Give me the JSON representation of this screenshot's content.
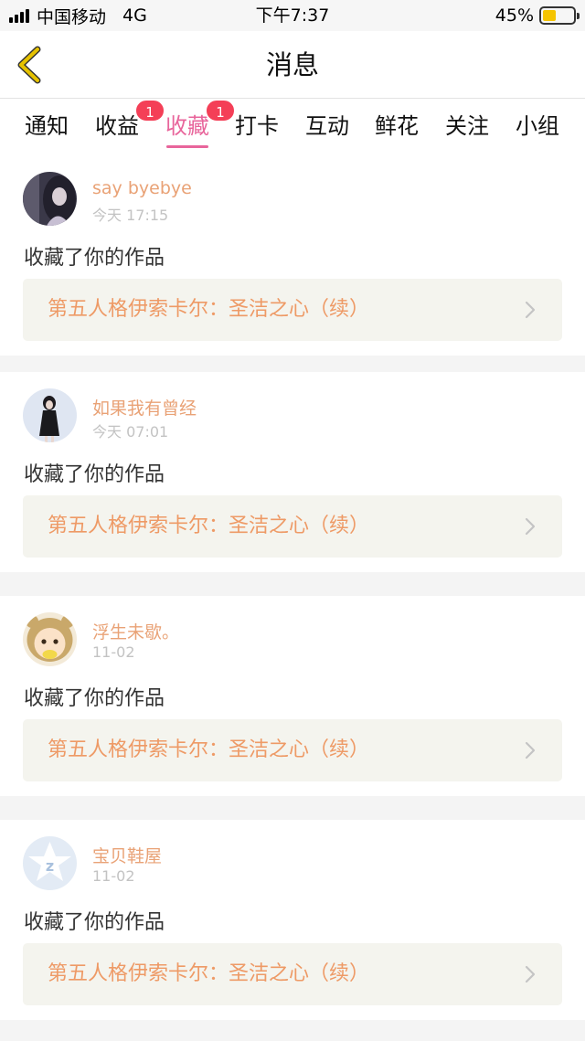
{
  "status_bar": {
    "carrier": "中国移动",
    "network": "4G",
    "time": "下午7:37",
    "battery": "45%",
    "battery_level": 0.45,
    "battery_color": "#f5c400"
  },
  "header": {
    "title": "消息",
    "back_icon": "chevron-left-icon",
    "back_color": "#e6c200"
  },
  "tabs": [
    {
      "label": "通知",
      "badge": ""
    },
    {
      "label": "收益",
      "badge": "1"
    },
    {
      "label": "收藏",
      "badge": "1",
      "active": true
    },
    {
      "label": "打卡",
      "badge": ""
    },
    {
      "label": "互动",
      "badge": ""
    },
    {
      "label": "鲜花",
      "badge": ""
    },
    {
      "label": "关注",
      "badge": ""
    },
    {
      "label": "小组",
      "badge": ""
    }
  ],
  "accent_color": "#e8659b",
  "messages": [
    {
      "username": "say byebye",
      "time": "今天 17:15",
      "action": "收藏了你的作品",
      "work_title": "第五人格伊索卡尔：圣洁之心（续）",
      "avatar_icon": "avatar-dark-hair"
    },
    {
      "username": "如果我有曾经",
      "time": "今天 07:01",
      "action": "收藏了你的作品",
      "work_title": "第五人格伊索卡尔：圣洁之心（续）",
      "avatar_icon": "avatar-girl-black-dress"
    },
    {
      "username": "浮生未歇。",
      "time": "11-02",
      "action": "收藏了你的作品",
      "work_title": "第五人格伊索卡尔：圣洁之心（续）",
      "avatar_icon": "avatar-cartoon-hood"
    },
    {
      "username": "宝贝鞋屋",
      "time": "11-02",
      "action": "收藏了你的作品",
      "work_title": "第五人格伊索卡尔：圣洁之心（续）",
      "avatar_icon": "avatar-qzone-default"
    }
  ]
}
